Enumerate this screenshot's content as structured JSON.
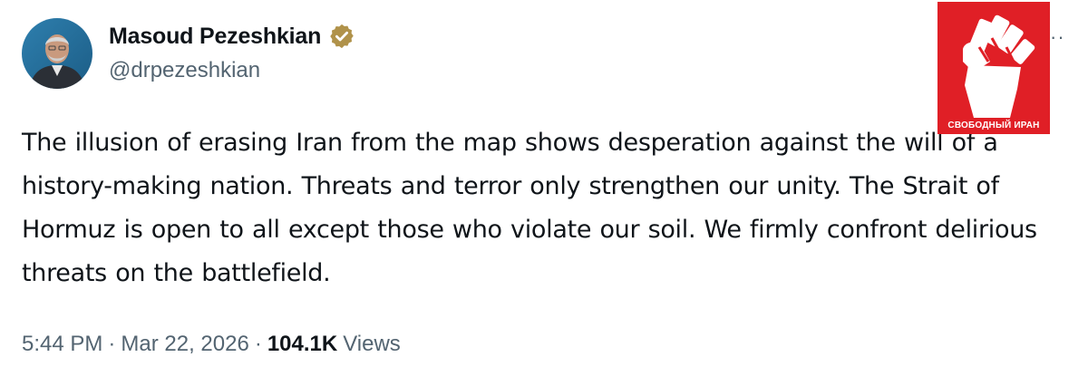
{
  "author": {
    "display_name": "Masoud Pezeshkian",
    "handle": "@drpezeshkian",
    "verified_icon": "verified-badge-icon",
    "avatar": "avatar-photo"
  },
  "tweet": {
    "text": "The illusion of erasing Iran from the map shows desperation against the will of a history-making nation. Threats and terror only strengthen our unity. The Strait of Hormuz is open to all except those who violate our soil. We firmly confront delirious threats on the battlefield.",
    "time": "5:44 PM",
    "separator": "·",
    "date": "Mar 22, 2026",
    "views_count": "104.1K",
    "views_label": "Views"
  },
  "menu": {
    "more_label": "··"
  },
  "watermark": {
    "label": "СВОБОДНЫЙ ИРАН",
    "icon": "raised-fist-icon",
    "background_color": "#e01f26"
  },
  "colors": {
    "text_primary": "#0f1419",
    "text_secondary": "#536471",
    "verified_gold": "#b0924a"
  }
}
